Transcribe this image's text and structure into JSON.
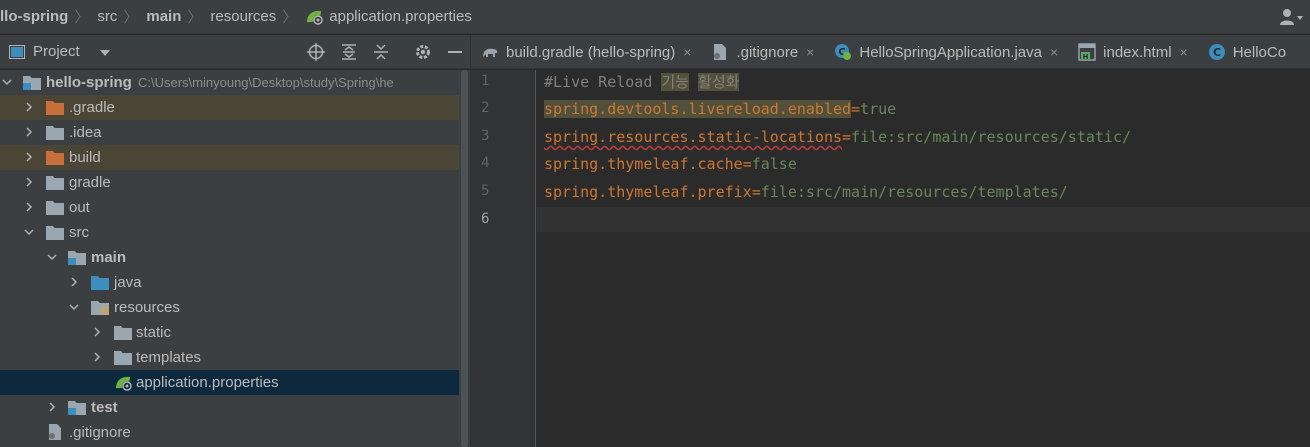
{
  "breadcrumb": [
    {
      "label": "llo-spring",
      "bold": true
    },
    {
      "label": "src",
      "bold": false
    },
    {
      "label": "main",
      "bold": true
    },
    {
      "label": "resources",
      "bold": false
    },
    {
      "label": "application.properties",
      "bold": false
    }
  ],
  "project_panel": {
    "title": "Project"
  },
  "tree": {
    "root_label": "hello-spring",
    "root_path": "C:\\Users\\minyoung\\Desktop\\study\\Spring\\he",
    "gradle_hidden": ".gradle",
    "idea": ".idea",
    "build": "build",
    "gradle": "gradle",
    "out": "out",
    "src": "src",
    "main": "main",
    "java": "java",
    "resources": "resources",
    "static": "static",
    "templates": "templates",
    "app_props": "application.properties",
    "test": "test",
    "gitignore": ".gitignore"
  },
  "tabs": [
    {
      "label": "build.gradle (hello-spring)",
      "icon": "gradle-elephant-icon",
      "close": "×"
    },
    {
      "label": ".gitignore",
      "icon": "gitignore-file-icon",
      "close": "×"
    },
    {
      "label": "HelloSpringApplication.java",
      "icon": "spring-class-icon",
      "close": "×"
    },
    {
      "label": "index.html",
      "icon": "html-file-icon",
      "close": "×"
    },
    {
      "label": "HelloCo",
      "icon": "class-icon",
      "close": ""
    }
  ],
  "editor": {
    "line_numbers": [
      "1",
      "2",
      "3",
      "4",
      "5",
      "6"
    ],
    "current_line": 6,
    "lines": {
      "l1_comment": "#Live Reload ",
      "l1_kr1": "기능",
      "l1_space": " ",
      "l1_kr2": "활성화",
      "l2_key": "spring.devtools.livereload.enabled",
      "l2_eq": "=",
      "l2_val": "true",
      "l3_key": "spring.resources.static-locations",
      "l3_eq": "=",
      "l3_val": "file:src/main/resources/static/",
      "l4_key": "spring.thymeleaf.cache",
      "l4_eq": "=",
      "l4_val": "false",
      "l5_key": "spring.thymeleaf.prefix",
      "l5_eq": "=",
      "l5_val": "file:src/main/resources/templates/"
    }
  },
  "colors": {
    "folder_excluded": "#c96f3b",
    "folder_normal": "#9aa7b0",
    "folder_source": "#3d8dbd",
    "keyword": "#cc7832",
    "string_value": "#6a8759",
    "comment": "#808080"
  }
}
